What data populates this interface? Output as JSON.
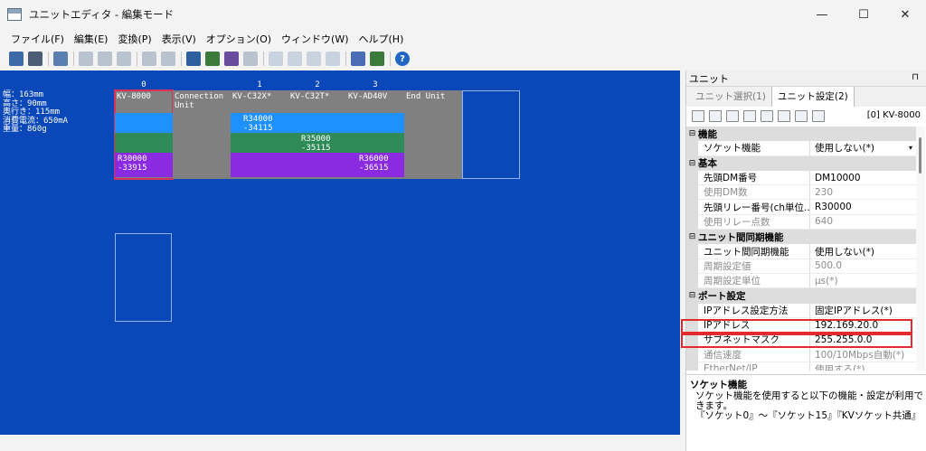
{
  "window": {
    "title": "ユニットエディタ - 編集モード",
    "minimize": "—",
    "maximize": "☐",
    "close": "✕"
  },
  "menu": [
    "ファイル(F)",
    "編集(E)",
    "変換(P)",
    "表示(V)",
    "オプション(O)",
    "ウィンドウ(W)",
    "ヘルプ(H)"
  ],
  "canvas": {
    "specs": "幅：163mm\n高さ：90mm\n奥行き：115mm\n消費電流：650mA\n重量：860g",
    "columns": [
      "0",
      "1",
      "2",
      "3"
    ],
    "units": [
      {
        "name": "KV-8000",
        "label": "R30000\n-33915"
      },
      {
        "name": "Connection\nUnit",
        "label": ""
      },
      {
        "name": "KV-C32X*",
        "label": "R34000\n-34115"
      },
      {
        "name": "KV-C32T*",
        "label": "R35000\n-35115"
      },
      {
        "name": "KV-AD40V",
        "label": "R36000\n-36515"
      },
      {
        "name": "End Unit",
        "label": ""
      }
    ]
  },
  "panel": {
    "title": "ユニット",
    "pin": "⊓",
    "tabs": [
      "ユニット選択(1)",
      "ユニット設定(2)"
    ],
    "unit_ref": "[0] KV-8000",
    "categories": [
      {
        "name": "機能",
        "rows": [
          {
            "name": "ソケット機能",
            "value": "使用しない(*)",
            "dropdown": "▾"
          }
        ]
      },
      {
        "name": "基本",
        "rows": [
          {
            "name": "先頭DM番号",
            "value": "DM10000"
          },
          {
            "name": "使用DM数",
            "value": "230",
            "disabled": true
          },
          {
            "name": "先頭リレー番号(ch単位...",
            "value": "R30000"
          },
          {
            "name": "使用リレー点数",
            "value": "640",
            "disabled": true
          }
        ]
      },
      {
        "name": "ユニット間同期機能",
        "rows": [
          {
            "name": "ユニット間同期機能",
            "value": "使用しない(*)"
          },
          {
            "name": "周期設定値",
            "value": "500.0",
            "disabled": true
          },
          {
            "name": "周期設定単位",
            "value": "μs(*)",
            "disabled": true
          }
        ]
      },
      {
        "name": "ポート設定",
        "rows": [
          {
            "name": "IPアドレス設定方法",
            "value": "固定IPアドレス(*)"
          },
          {
            "name": "IPアドレス",
            "value": "192.169.20.0"
          },
          {
            "name": "サブネットマスク",
            "value": "255.255.0.0"
          },
          {
            "name": "通信速度",
            "value": "100/10Mbps自動(*)",
            "disabled": true
          },
          {
            "name": "EtherNet/IP",
            "value": "使用する(*)",
            "disabled": true
          }
        ]
      }
    ],
    "desc_title": "ソケット機能",
    "desc_body": "ソケット機能を使用すると以下の機能・設定が利用できます。\n『ソケット0』～『ソケット15』『KVソケット共通』"
  },
  "colors": {
    "canvas_bg": "#0a47b8",
    "unit_gray": "#808080",
    "band_blue": "#1e90ff",
    "band_green": "#2e8b57",
    "band_purple": "#8a2be2",
    "highlight": "#e32b2b"
  }
}
